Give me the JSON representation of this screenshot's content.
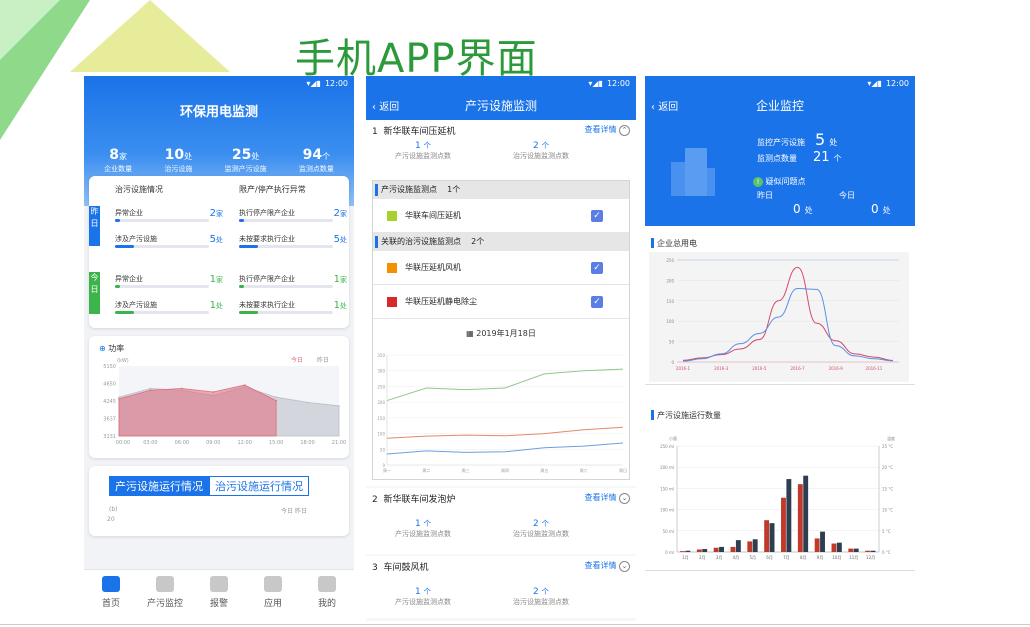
{
  "heading": "手机APP界面",
  "status_time": "12:00",
  "phone1": {
    "title": "环保用电监测",
    "stats": [
      {
        "num": "8",
        "unit": "家",
        "label": "企业数量"
      },
      {
        "num": "10",
        "unit": "处",
        "label": "治污设施"
      },
      {
        "num": "25",
        "unit": "处",
        "label": "监测产污设施"
      },
      {
        "num": "94",
        "unit": "个",
        "label": "监测点数量"
      }
    ],
    "left_header": "治污设施情况",
    "right_header": "限产/停产执行异常",
    "yesterday_tag": "昨日",
    "today_tag": "今日",
    "yesterday": [
      {
        "label": "异常企业",
        "value": "2",
        "unit": "家",
        "fill": 0.05
      },
      {
        "label": "涉及产污设施",
        "value": "5",
        "unit": "处",
        "fill": 0.2
      },
      {
        "label": "执行停产限产企业",
        "value": "2",
        "unit": "家",
        "fill": 0.05
      },
      {
        "label": "未按要求执行企业",
        "value": "5",
        "unit": "处",
        "fill": 0.2
      }
    ],
    "today": [
      {
        "label": "异常企业",
        "value": "1",
        "unit": "家",
        "fill": 0.05
      },
      {
        "label": "涉及产污设施",
        "value": "1",
        "unit": "处",
        "fill": 0.2
      },
      {
        "label": "执行停产限产企业",
        "value": "1",
        "unit": "家",
        "fill": 0.05
      },
      {
        "label": "未按要求执行企业",
        "value": "1",
        "unit": "处",
        "fill": 0.2
      }
    ],
    "power_title": "功率",
    "power_unit": "(kW)",
    "legend_today": "今日",
    "legend_yesterday": "昨日",
    "power_yticks": [
      "5150",
      "4650",
      "4245",
      "3637",
      "3131"
    ],
    "power_xticks": [
      "00:00",
      "03:00",
      "06:00",
      "09:00",
      "12:00",
      "15:00",
      "18:00",
      "21:00"
    ],
    "tab1": "产污设施运行情况",
    "tab2": "治污设施运行情况",
    "run_unit": "(b)",
    "run_ytick": "20",
    "nav": [
      "首页",
      "产污监控",
      "报警",
      "应用",
      "我的"
    ]
  },
  "phone2": {
    "back": "返回",
    "title": "产污设施监测",
    "detail": "查看详情",
    "sections": [
      {
        "index": "1",
        "name": "新华联车间压延机",
        "a": "1",
        "a_unit": "个",
        "a_label": "产污设施监测点数",
        "b": "2",
        "b_unit": "个",
        "b_label": "治污设施监测点数"
      },
      {
        "index": "2",
        "name": "新华联车间发泡炉",
        "a": "1",
        "a_unit": "个",
        "a_label": "产污设施监测点数",
        "b": "2",
        "b_unit": "个",
        "b_label": "治污设施监测点数"
      },
      {
        "index": "3",
        "name": "车间鼓风机",
        "a": "1",
        "a_unit": "个",
        "a_label": "产污设施监测点数",
        "b": "2",
        "b_unit": "个",
        "b_label": "治污设施监测点数"
      }
    ],
    "group1_title": "产污设施监测点",
    "group1_count": "1个",
    "group1_items": [
      {
        "name": "华联车间压延机",
        "color": "#a8d22d"
      }
    ],
    "group2_title": "关联的治污设施监测点",
    "group2_count": "2个",
    "group2_items": [
      {
        "name": "华联压延机风机",
        "color": "#f39200"
      },
      {
        "name": "华联压延机静电除尘",
        "color": "#d62b2b"
      }
    ],
    "check": "✓",
    "date": "2019年1月18日",
    "line_yticks": [
      "350",
      "300",
      "250",
      "200",
      "150",
      "100",
      "50",
      "0"
    ],
    "line_xticks": [
      "周一",
      "周二",
      "周三",
      "周四",
      "周五",
      "周六",
      "周日"
    ]
  },
  "phone3": {
    "back": "返回",
    "title": "企业监控",
    "k1_label": "监控产污设施",
    "k1_value": "5",
    "k1_unit": "处",
    "k2_label": "监测点数量",
    "k2_value": "21",
    "k2_unit": "个",
    "issue_label": "疑似问题点",
    "yesterday": "昨日",
    "today": "今日",
    "y_value": "0",
    "y_unit": "处",
    "t_value": "0",
    "t_unit": "处",
    "chart1_title": "企业总用电",
    "chart1_yticks": [
      "250",
      "200",
      "150",
      "100",
      "50",
      "0"
    ],
    "chart1_xticks": [
      "2016-1",
      "2016-3",
      "2016-5",
      "2016-7",
      "2016-9",
      "2016-11"
    ],
    "chart2_title": "产污设施运行数量",
    "chart2_left_unit": "小量",
    "chart2_right_unit": "温度",
    "chart2_yticks": [
      "250 ml",
      "200 ml",
      "150 ml",
      "100 ml",
      "50 ml",
      "0 ml"
    ],
    "chart2_rticks": [
      "25 °C",
      "20 °C",
      "15 °C",
      "10 °C",
      "5 °C",
      "0 °C"
    ],
    "chart2_xticks": [
      "1月",
      "2月",
      "3月",
      "4月",
      "5月",
      "6月",
      "7月",
      "8月",
      "9月",
      "10月",
      "11月",
      "12月"
    ]
  },
  "chart_data": [
    {
      "type": "area",
      "title": "功率",
      "ylabel": "(kW)",
      "x": [
        "00:00",
        "03:00",
        "06:00",
        "09:00",
        "12:00",
        "15:00",
        "18:00",
        "21:00"
      ],
      "ylim": [
        3131,
        5150
      ],
      "series": [
        {
          "name": "今日",
          "color": "#e06a7a",
          "values": [
            4200,
            4450,
            4500,
            4400,
            4600,
            4150,
            null,
            null
          ]
        },
        {
          "name": "昨日",
          "color": "#b9bcc8",
          "values": [
            4250,
            4500,
            4450,
            4300,
            4550,
            4250,
            4100,
            4000
          ]
        }
      ]
    },
    {
      "type": "line",
      "x": [
        "周一",
        "周二",
        "周三",
        "周四",
        "周五",
        "周六",
        "周日"
      ],
      "ylim": [
        0,
        350
      ],
      "series": [
        {
          "color": "#8fc98a",
          "values": [
            205,
            245,
            240,
            245,
            290,
            300,
            305
          ]
        },
        {
          "color": "#e3886c",
          "values": [
            85,
            92,
            95,
            93,
            100,
            112,
            120
          ]
        },
        {
          "color": "#6d9fe0",
          "values": [
            35,
            45,
            40,
            42,
            55,
            60,
            70
          ]
        }
      ]
    },
    {
      "type": "line",
      "title": "企业总用电",
      "x": [
        "2016-1",
        "2016-2",
        "2016-3",
        "2016-4",
        "2016-5",
        "2016-6",
        "2016-7",
        "2016-8",
        "2016-9",
        "2016-10",
        "2016-11",
        "2016-12"
      ],
      "ylim": [
        0,
        250
      ],
      "series": [
        {
          "color": "#d64a6a",
          "values": [
            4,
            10,
            18,
            32,
            55,
            150,
            232,
            95,
            52,
            20,
            12,
            4
          ]
        },
        {
          "color": "#5b8fe3",
          "values": [
            2,
            8,
            20,
            45,
            70,
            110,
            180,
            178,
            40,
            15,
            8,
            3
          ]
        }
      ]
    },
    {
      "type": "bar",
      "title": "产污设施运行数量",
      "categories": [
        "1月",
        "2月",
        "3月",
        "4月",
        "5月",
        "6月",
        "7月",
        "8月",
        "9月",
        "10月",
        "11月",
        "12月"
      ],
      "ylim": [
        0,
        250
      ],
      "series": [
        {
          "color": "#c0392b",
          "values": [
            2,
            6,
            10,
            12,
            25,
            75,
            128,
            160,
            32,
            20,
            8,
            3
          ]
        },
        {
          "color": "#2c3e50",
          "values": [
            3,
            7,
            12,
            28,
            30,
            68,
            172,
            180,
            48,
            22,
            8,
            3
          ]
        }
      ]
    }
  ]
}
